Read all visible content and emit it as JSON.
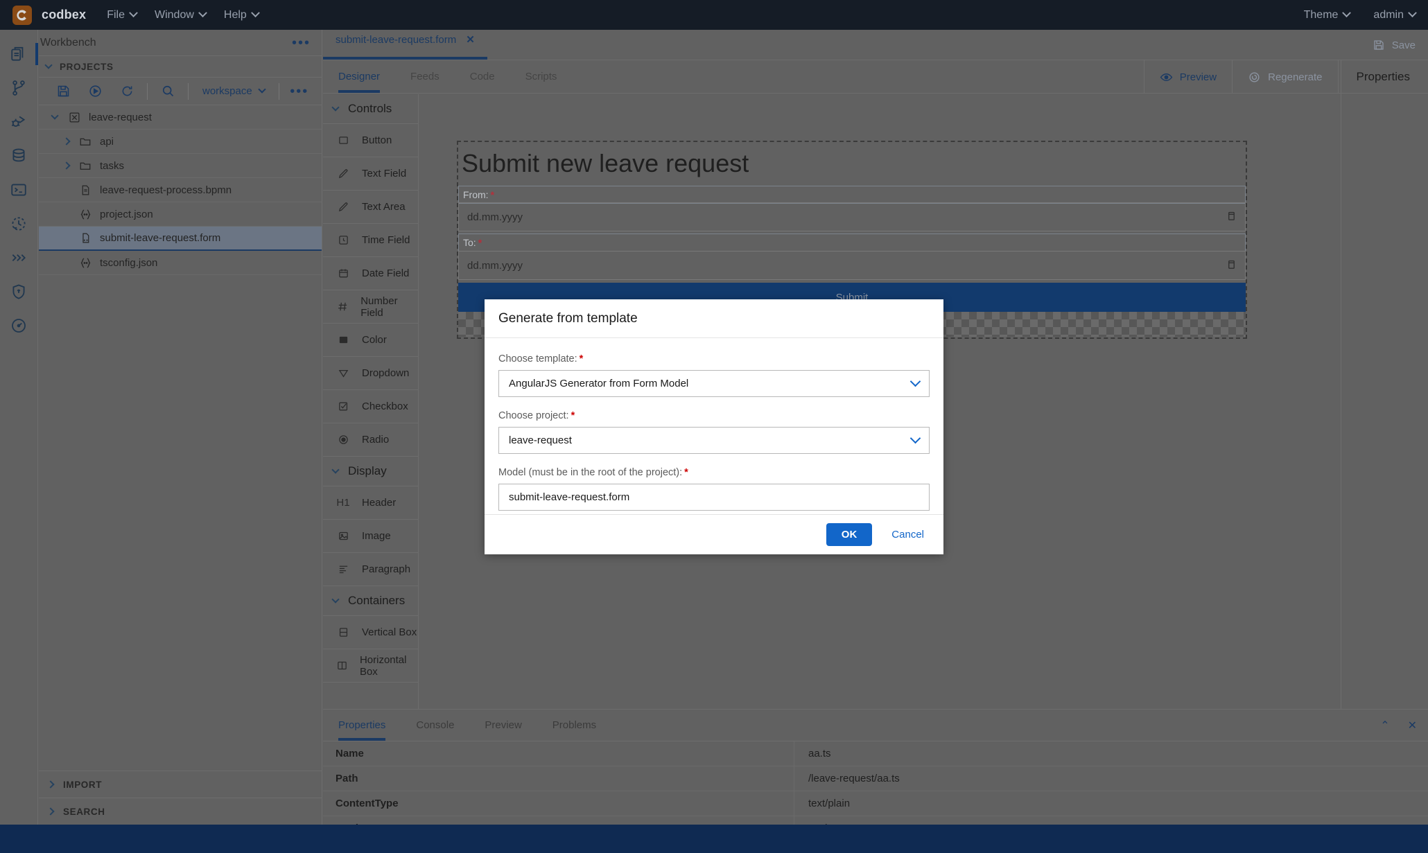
{
  "titlebar": {
    "brand": "codbex",
    "menus": [
      "File",
      "Window",
      "Help"
    ],
    "right": [
      "Theme",
      "admin"
    ]
  },
  "activitybar": {
    "icons": [
      {
        "name": "explorer-icon",
        "active": true
      },
      {
        "name": "source-control-icon",
        "active": false
      },
      {
        "name": "debug-icon",
        "active": false
      },
      {
        "name": "database-icon",
        "active": false
      },
      {
        "name": "terminal-icon",
        "active": false
      },
      {
        "name": "history-icon",
        "active": false
      },
      {
        "name": "chevrons-icon",
        "active": false
      },
      {
        "name": "security-icon",
        "active": false
      },
      {
        "name": "gauge-icon",
        "active": false
      }
    ]
  },
  "leftpanel": {
    "title": "Workbench",
    "section": "PROJECTS",
    "toolbar": {
      "save": "save-icon",
      "run": "run-icon",
      "refresh": "refresh-icon",
      "search": "search-icon",
      "workspace_label": "workspace",
      "more": "more-icon"
    },
    "tree": [
      {
        "label": "leave-request",
        "icon": "project-icon",
        "depth": 0,
        "arrow": "down",
        "selected": false
      },
      {
        "label": "api",
        "icon": "folder-icon",
        "depth": 1,
        "arrow": "right",
        "selected": false
      },
      {
        "label": "tasks",
        "icon": "folder-icon",
        "depth": 1,
        "arrow": "right",
        "selected": false
      },
      {
        "label": "leave-request-process.bpmn",
        "icon": "bpmn-file-icon",
        "depth": 1,
        "arrow": "",
        "selected": false
      },
      {
        "label": "project.json",
        "icon": "json-file-icon",
        "depth": 1,
        "arrow": "",
        "selected": false
      },
      {
        "label": "submit-leave-request.form",
        "icon": "form-file-icon",
        "depth": 1,
        "arrow": "",
        "selected": true
      },
      {
        "label": "tsconfig.json",
        "icon": "json-file-icon",
        "depth": 1,
        "arrow": "",
        "selected": false
      }
    ],
    "collapsed_sections": [
      "IMPORT",
      "SEARCH"
    ]
  },
  "editor": {
    "tab": {
      "label": "submit-leave-request.form",
      "close": "✕"
    },
    "save_label": "Save",
    "subtabs": [
      {
        "label": "Designer",
        "active": true
      },
      {
        "label": "Feeds",
        "active": false
      },
      {
        "label": "Code",
        "active": false
      },
      {
        "label": "Scripts",
        "active": false
      }
    ],
    "actions": {
      "preview": "Preview",
      "regenerate": "Regenerate",
      "properties": "Properties"
    }
  },
  "palette": {
    "groups": [
      {
        "label": "Controls",
        "items": [
          {
            "label": "Button",
            "icon": "square-icon"
          },
          {
            "label": "Text Field",
            "icon": "pencil-icon"
          },
          {
            "label": "Text Area",
            "icon": "pencil-icon"
          },
          {
            "label": "Time Field",
            "icon": "clock-icon"
          },
          {
            "label": "Date Field",
            "icon": "calendar-icon"
          },
          {
            "label": "Number Field",
            "icon": "hash-icon"
          },
          {
            "label": "Color",
            "icon": "color-swatch-icon"
          },
          {
            "label": "Dropdown",
            "icon": "triangle-down-icon"
          },
          {
            "label": "Checkbox",
            "icon": "checkbox-icon"
          },
          {
            "label": "Radio",
            "icon": "radio-icon"
          }
        ]
      },
      {
        "label": "Display",
        "items": [
          {
            "label": "Header",
            "icon": "h1-icon"
          },
          {
            "label": "Image",
            "icon": "image-icon"
          },
          {
            "label": "Paragraph",
            "icon": "paragraph-icon"
          }
        ]
      },
      {
        "label": "Containers",
        "items": [
          {
            "label": "Vertical Box",
            "icon": "vertical-box-icon"
          },
          {
            "label": "Horizontal Box",
            "icon": "horizontal-box-icon"
          }
        ]
      }
    ]
  },
  "form_canvas": {
    "title": "Submit new leave request",
    "fields": [
      {
        "label": "From:",
        "required": "*",
        "placeholder": "dd.mm.yyyy"
      },
      {
        "label": "To:",
        "required": "*",
        "placeholder": "dd.mm.yyyy"
      }
    ],
    "submit_label": "Submit"
  },
  "bottompanel": {
    "tabs": [
      {
        "label": "Properties",
        "active": true
      },
      {
        "label": "Console",
        "active": false
      },
      {
        "label": "Preview",
        "active": false
      },
      {
        "label": "Problems",
        "active": false
      }
    ],
    "actions": {
      "collapse": "⌃",
      "close": "✕"
    },
    "rows": [
      {
        "key": "Name",
        "value": "aa.ts"
      },
      {
        "key": "Path",
        "value": "/leave-request/aa.ts"
      },
      {
        "key": "ContentType",
        "value": "text/plain"
      },
      {
        "key": "Workspace",
        "value": "workspace"
      }
    ]
  },
  "modal": {
    "title": "Generate from template",
    "fields": [
      {
        "label": "Choose template:",
        "required": "*",
        "type": "select",
        "value": "AngularJS Generator from Form Model"
      },
      {
        "label": "Choose project:",
        "required": "*",
        "type": "select",
        "value": "leave-request"
      },
      {
        "label": "Model (must be in the root of the project):",
        "required": "*",
        "type": "text",
        "value": "submit-leave-request.form"
      }
    ],
    "ok_label": "OK",
    "cancel_label": "Cancel"
  },
  "colors": {
    "titlebar_bg": "#151c26",
    "panel_bg": "#616161",
    "accent_blue": "#1b3a63",
    "status_bar": "#0f2a52",
    "modal_primary": "#1266c9",
    "required_red": "#cc0000",
    "logo_bg": "#8a4b16"
  }
}
